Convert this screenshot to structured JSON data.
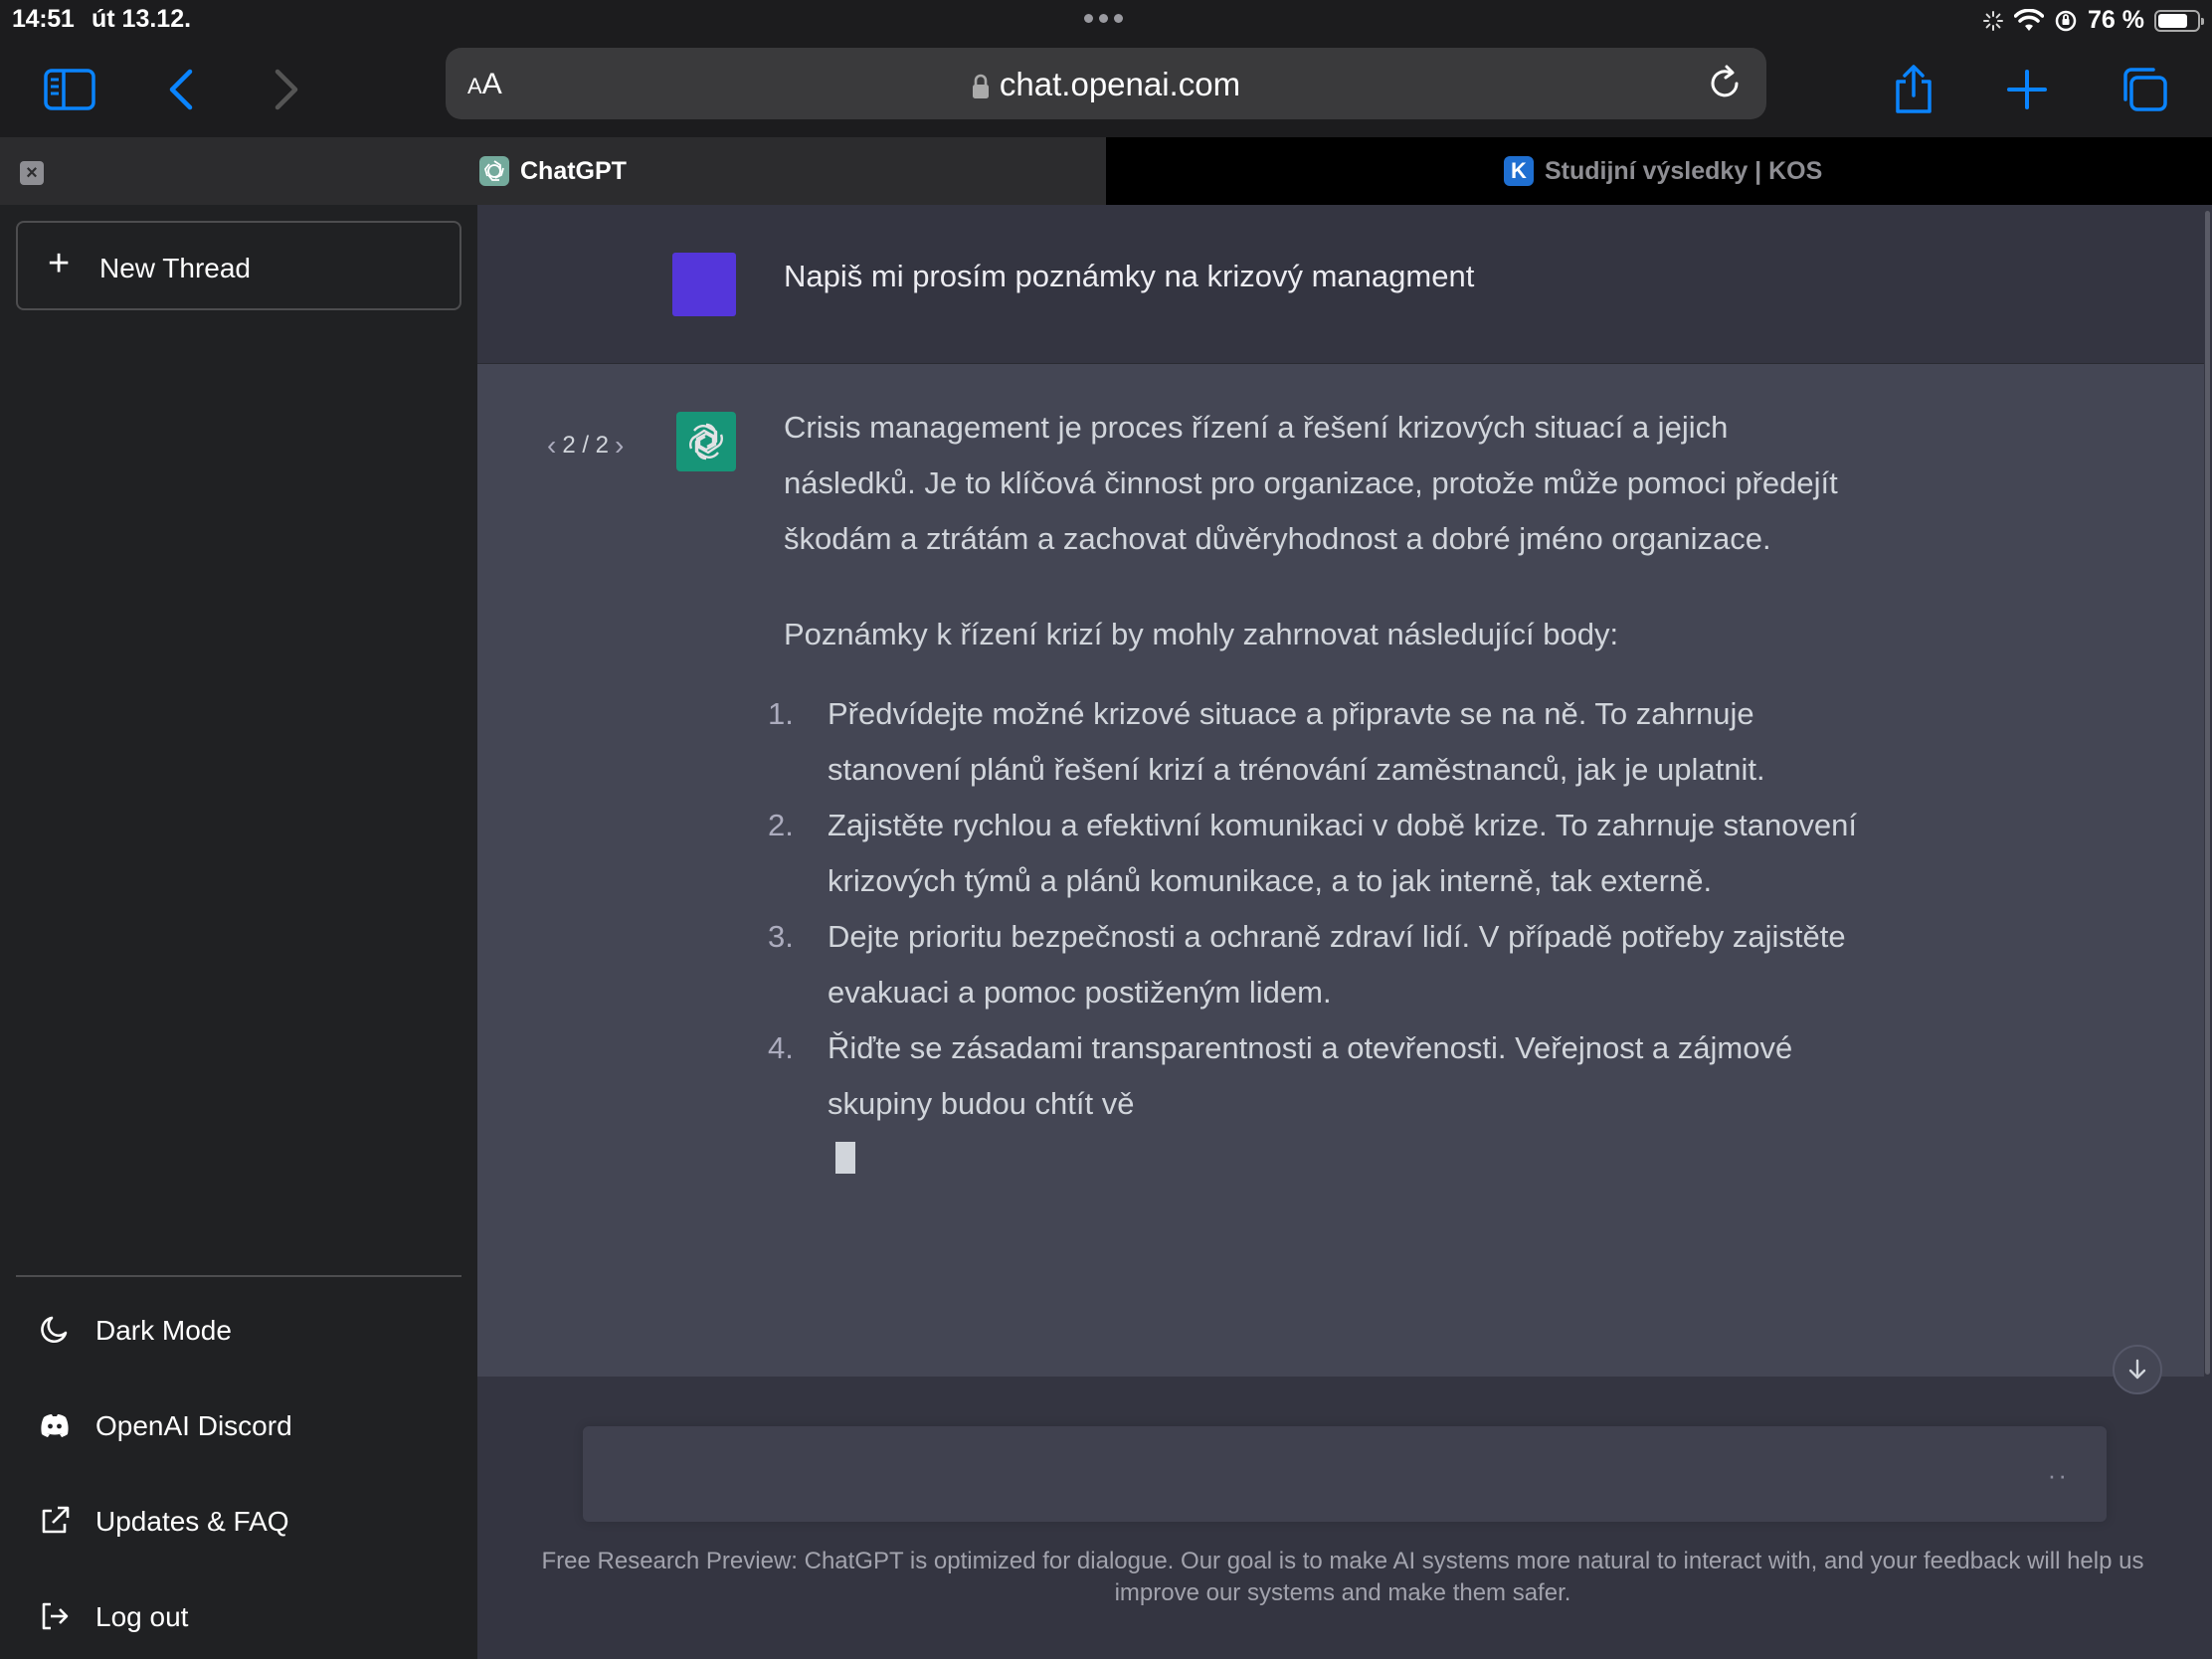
{
  "status_bar": {
    "time": "14:51",
    "date": "út 13.12.",
    "battery_pct": "76 %",
    "battery_level": 0.76
  },
  "browser": {
    "text_size_label": "AA",
    "url": "chat.openai.com",
    "tabs": [
      {
        "title": "ChatGPT",
        "active": true
      },
      {
        "title": "Studijní výsledky | KOS",
        "active": false,
        "favicon_letter": "K"
      }
    ]
  },
  "sidebar": {
    "new_thread_label": "New Thread",
    "items": [
      {
        "label": "Dark Mode",
        "icon": "moon-icon"
      },
      {
        "label": "OpenAI Discord",
        "icon": "discord-icon"
      },
      {
        "label": "Updates & FAQ",
        "icon": "external-link-icon"
      },
      {
        "label": "Log out",
        "icon": "logout-icon"
      }
    ]
  },
  "conversation": {
    "user_message": "Napiš mi prosím poznámky na krizový managment",
    "pager": "2 / 2",
    "response_intro": "Crisis management je proces řízení a řešení krizových situací a jejich následků. Je to klíčová činnost pro organizace, protože může pomoci předejít škodám a ztrátám a zachovat důvěryhodnost a dobré jméno organizace.",
    "response_lead": "Poznámky k řízení krizí by mohly zahrnovat následující body:",
    "points": [
      {
        "num": "1.",
        "text": "Předvídejte možné krizové situace a připravte se na ně. To zahrnuje stanovení plánů řešení krizí a trénování zaměstnanců, jak je uplatnit."
      },
      {
        "num": "2.",
        "text": "Zajistěte rychlou a efektivní komunikaci v době krize. To zahrnuje stanovení krizových týmů a plánů komunikace, a to jak interně, tak externě."
      },
      {
        "num": "3.",
        "text": "Dejte prioritu bezpečnosti a ochraně zdraví lidí. V případě potřeby zajistěte evakuaci a pomoc postiženým lidem."
      },
      {
        "num": "4.",
        "text": "Řiďte se zásadami transparentnosti a otevřenosti. Veřejnost a zájmové skupiny budou chtít vě"
      }
    ]
  },
  "composer": {
    "value": "",
    "typing_indicator": "··"
  },
  "footer_note": "Free Research Preview: ChatGPT is optimized for dialogue. Our goal is to make AI systems more natural to interact with, and your feedback will help us improve our systems and make them safer.",
  "colors": {
    "sidebar_bg": "#202123",
    "main_bg": "#343541",
    "assistant_bg": "#444654",
    "accent_blue": "#0a84ff",
    "user_avatar": "#5436da",
    "bot_avatar": "#10a37f"
  }
}
